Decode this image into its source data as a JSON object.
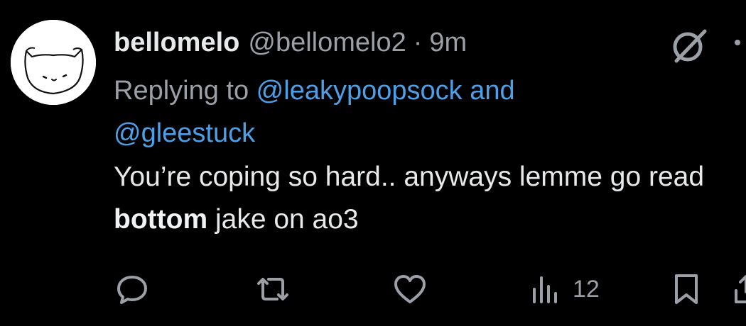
{
  "tweet": {
    "display_name": "bellomelo",
    "handle": "@bellomelo2",
    "separator": "·",
    "time": "9m",
    "replying_prefix": "Replying to ",
    "mention_1": "@leakypoopsock",
    "mention_joiner": " and",
    "mention_2": "@gleestuck",
    "text_part1": "You’re coping so hard.. anyways lemme go read ",
    "text_bold": "bottom",
    "text_part2": " jake on ao3"
  },
  "actions": {
    "views_count": "12",
    "icons": [
      "reply-icon",
      "retweet-icon",
      "like-icon",
      "views-icon",
      "bookmark-icon",
      "share-icon"
    ]
  },
  "header_icons": [
    "grok-icon",
    "more-icon"
  ],
  "colors": {
    "background": "#000000",
    "primary_text": "#e7e9ea",
    "secondary_text": "#9aa0a6",
    "link": "#4d9fe8"
  }
}
